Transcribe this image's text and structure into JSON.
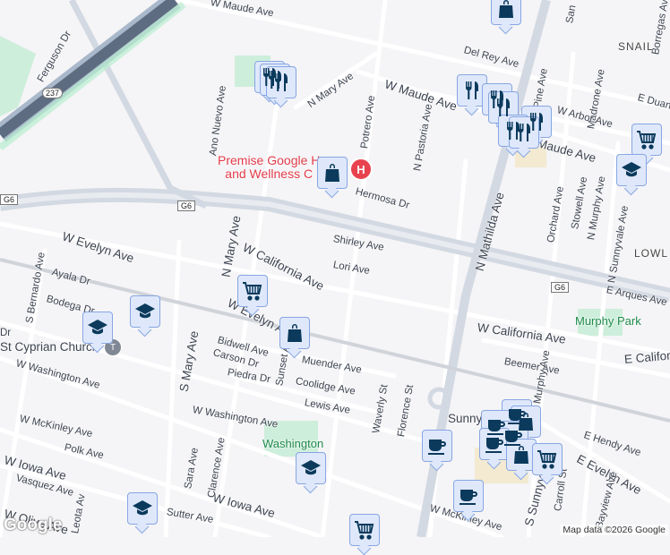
{
  "map": {
    "streets": [
      "W Maude Ave",
      "W Maude Ave",
      "Del Rey Ave",
      "N Mary Ave",
      "Ano Nuevo Ave",
      "Potrero Ave",
      "N Pastoria Ave",
      "Ferguson Dr",
      "Hermosa Dr",
      "Shirley Ave",
      "Lori Ave",
      "N Mary Ave",
      "W California Ave",
      "W Evelyn Ave",
      "Ayala Dr",
      "Bodega Dr",
      "S Bernardo Ave",
      "W Washington Ave",
      "Bidwell Ave",
      "Carson Dr",
      "Piedra Dr",
      "Muender Ave",
      "Coolidge Ave",
      "Lewis Ave",
      "W Washington Ave",
      "W McKinley Ave",
      "Polk Ave",
      "W Iowa Ave",
      "Vasquez Ave",
      "W Olive Ave",
      "Sutter Ave",
      "W Iowa Ave",
      "Leota Av",
      "Sara Ave",
      "Clarence Ave",
      "S Mary Ave",
      "Sunset Av",
      "Waverly St",
      "Florence St",
      "W California Ave",
      "Beemer Ave",
      "E Californ",
      "E Arques Ave",
      "N Mathilda Ave",
      "Pine Ave",
      "Madrone Ave",
      "E Duane",
      "W Arbor Ave",
      "Maude Ave",
      "Orchard Ave",
      "Stowell Ave",
      "N Murphy Ave",
      "N Sunnyvale Ave",
      "Borregas Av",
      "San",
      "E Hendy Ave",
      "E Evelyn Ave",
      "S Sunnyvale",
      "Carroll St",
      "Bayview Ave",
      "W McKinley Ave",
      "Murphy Ave",
      "W Evelyn Av",
      "Dr"
    ],
    "districts": [
      "SNAIL",
      "LOWL"
    ],
    "places": {
      "poi_line1": "Premise Google H",
      "poi_line2": "and Wellness C",
      "church": "St Cyprian Church",
      "park1": "Murphy Park",
      "park2": "Washington",
      "sunny": "Sunny"
    },
    "shields": {
      "hwy": "237",
      "g6a": "G6",
      "g6b": "G6",
      "g6c": "G6"
    },
    "hospital_label": "H",
    "credit": "Map data ©2026 Google",
    "logo": "Google"
  },
  "colors": {
    "marker_bg": "#dfe8fb",
    "marker_border": "#86a6e2",
    "icon": "#0b3a5c",
    "poi": "#e23b49",
    "park": "#1e8a4a"
  }
}
